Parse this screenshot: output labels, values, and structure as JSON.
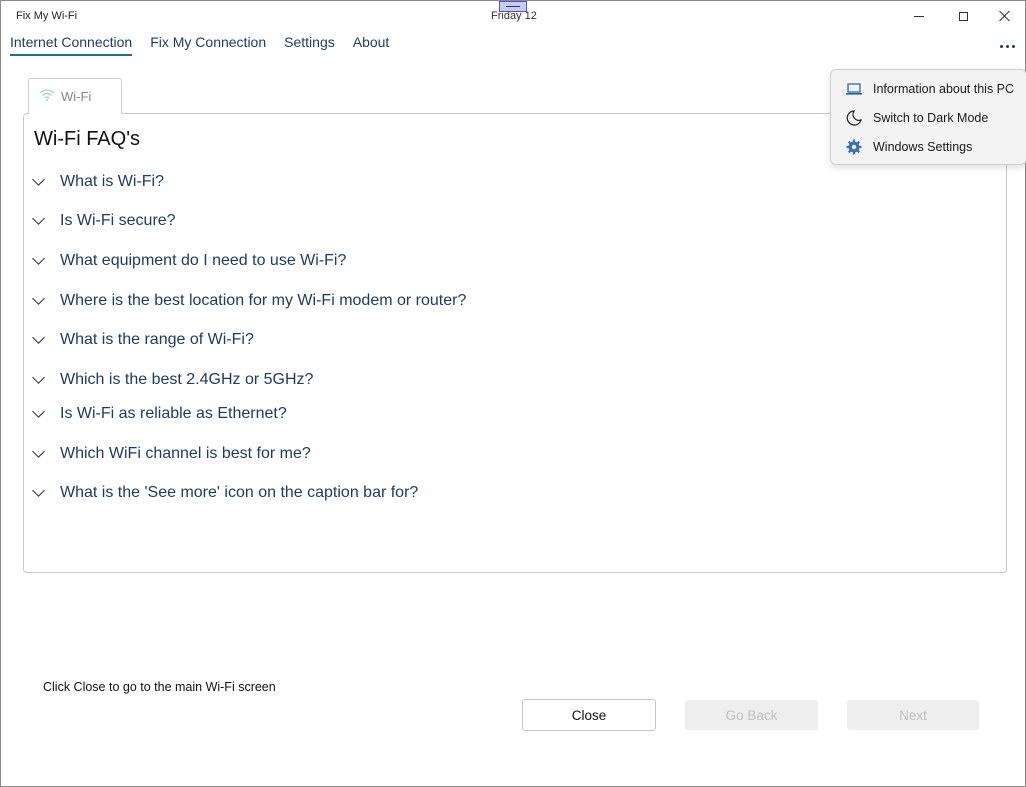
{
  "window": {
    "title": "Fix My Wi-Fi",
    "clock": "Friday 12"
  },
  "nav": {
    "items": [
      {
        "label": "Internet Connection",
        "active": true
      },
      {
        "label": "Fix My Connection"
      },
      {
        "label": "Settings"
      },
      {
        "label": "About"
      }
    ]
  },
  "tab": {
    "label": "Wi-Fi",
    "icon": "wifi-icon"
  },
  "faq": {
    "title": "Wi-Fi FAQ's",
    "questions": [
      "What is Wi-Fi?",
      "Is Wi-Fi secure?",
      "What equipment do I need to use Wi-Fi?",
      "Where is the best location for my Wi-Fi modem or router?",
      "What is the range of Wi-Fi?",
      "Which is the best 2.4GHz or 5GHz?",
      "Is Wi-Fi as reliable as Ethernet?",
      "Which WiFi channel is best for me?",
      "What is the 'See more' icon on the caption bar for?"
    ]
  },
  "menu": {
    "items": [
      {
        "label": "Information about this PC",
        "icon": "laptop-icon"
      },
      {
        "label": "Switch to Dark Mode",
        "icon": "moon-icon"
      },
      {
        "label": "Windows Settings",
        "icon": "gear-icon"
      }
    ]
  },
  "footer": {
    "hint": "Click Close to go to the main Wi-Fi screen",
    "close_label": "Close",
    "back_label": "Go Back",
    "next_label": "Next"
  },
  "colors": {
    "accent": "#1f6d9e",
    "link_text": "#1f3a5f",
    "disabled_text": "#c0c0c0"
  }
}
